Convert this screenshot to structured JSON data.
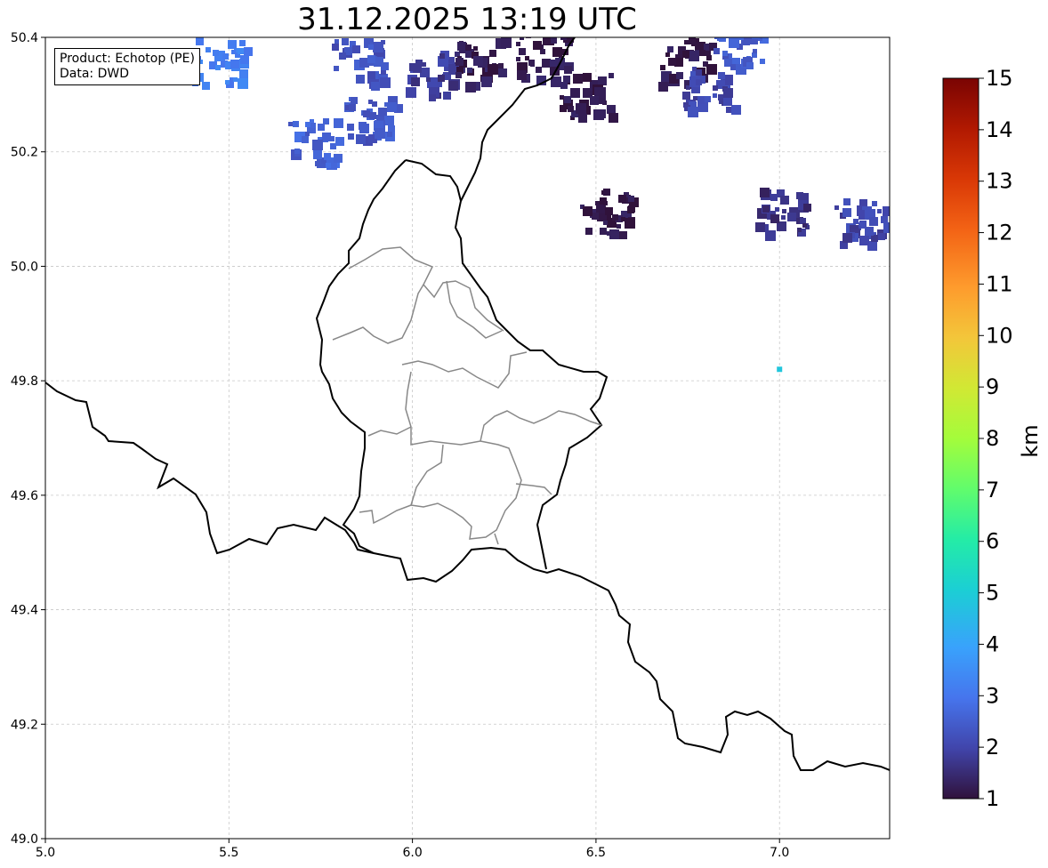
{
  "title": "31.12.2025 13:19 UTC",
  "info": {
    "product": "Product: Echotop (PE)",
    "source": "Data: DWD"
  },
  "map": {
    "lon_range": [
      5.0,
      7.3
    ],
    "lat_range": [
      49.0,
      50.4
    ],
    "x_ticks": [
      "5.0",
      "5.5",
      "6.0",
      "6.5",
      "7.0"
    ],
    "y_ticks": [
      "49.0",
      "49.2",
      "49.4",
      "49.6",
      "49.8",
      "50.0",
      "50.2",
      "50.4"
    ],
    "grid": true
  },
  "colorbar": {
    "label": "km",
    "min": 1,
    "max": 15,
    "ticks": [
      "1",
      "2",
      "3",
      "4",
      "5",
      "6",
      "7",
      "8",
      "9",
      "10",
      "11",
      "12",
      "13",
      "14",
      "15"
    ],
    "colormap": "turbo"
  },
  "echo_cells": [
    {
      "lon": 5.47,
      "lat": 50.36,
      "km": 3.2
    },
    {
      "lon": 5.72,
      "lat": 50.22,
      "km": 2.6
    },
    {
      "lon": 5.85,
      "lat": 50.36,
      "km": 2.3
    },
    {
      "lon": 5.88,
      "lat": 50.26,
      "km": 2.4
    },
    {
      "lon": 6.05,
      "lat": 50.34,
      "km": 1.8
    },
    {
      "lon": 6.18,
      "lat": 50.36,
      "km": 1.2
    },
    {
      "lon": 6.35,
      "lat": 50.37,
      "km": 1.2
    },
    {
      "lon": 6.47,
      "lat": 50.3,
      "km": 1.1
    },
    {
      "lon": 6.52,
      "lat": 50.1,
      "km": 1.1
    },
    {
      "lon": 6.74,
      "lat": 50.36,
      "km": 1.1
    },
    {
      "lon": 6.8,
      "lat": 50.31,
      "km": 2.0
    },
    {
      "lon": 6.88,
      "lat": 50.39,
      "km": 2.5
    },
    {
      "lon": 7.0,
      "lat": 50.1,
      "km": 1.6
    },
    {
      "lon": 7.22,
      "lat": 50.08,
      "km": 2.0
    },
    {
      "lon": 7.0,
      "lat": 49.82,
      "km": 4.8
    }
  ]
}
